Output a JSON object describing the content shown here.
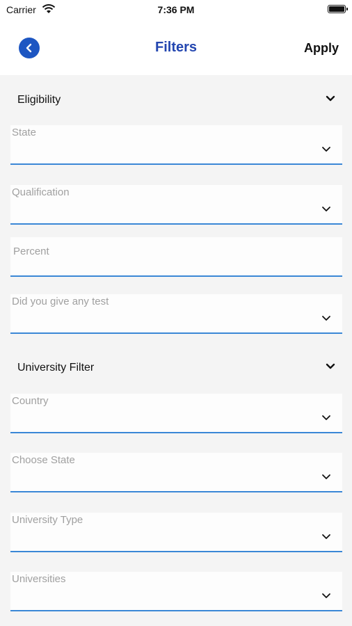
{
  "status_bar": {
    "carrier": "Carrier",
    "time": "7:36 PM"
  },
  "nav": {
    "title": "Filters",
    "apply_label": "Apply",
    "accent_color": "#1d56c2"
  },
  "sections": {
    "eligibility": {
      "title": "Eligibility",
      "fields": {
        "state": "State",
        "qualification": "Qualification",
        "percent": "Percent",
        "test": "Did you give any test"
      }
    },
    "university": {
      "title": "University Filter",
      "fields": {
        "country": "Country",
        "choose_state": "Choose State",
        "university_type": "University Type",
        "universities": "Universities"
      }
    }
  },
  "icons": [
    "wifi-icon",
    "battery-icon",
    "back-chevron-icon",
    "chevron-down-icon"
  ]
}
